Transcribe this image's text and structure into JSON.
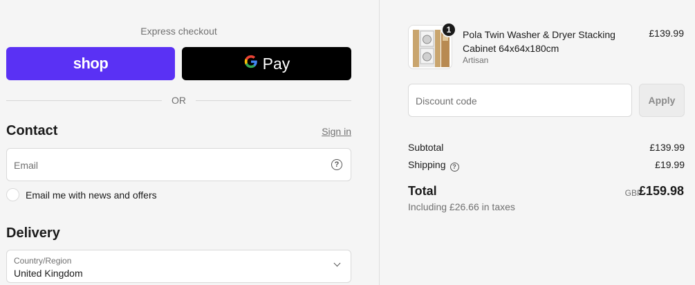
{
  "express": {
    "label": "Express checkout",
    "shop_label": "shop",
    "gpay_g": "G",
    "gpay_label": "Pay",
    "or_label": "OR"
  },
  "contact": {
    "heading": "Contact",
    "signin_label": "Sign in",
    "email_placeholder": "Email",
    "newsletter_label": "Email me with news and offers"
  },
  "delivery": {
    "heading": "Delivery",
    "country_label": "Country/Region",
    "country_value": "United Kingdom"
  },
  "order": {
    "product": {
      "name": "Pola Twin Washer & Dryer Stacking Cabinet 64x64x180cm",
      "variant": "Artisan",
      "price": "£139.99",
      "quantity": "1"
    },
    "discount_placeholder": "Discount code",
    "apply_label": "Apply",
    "subtotal_label": "Subtotal",
    "subtotal_value": "£139.99",
    "shipping_label": "Shipping",
    "shipping_value": "£19.99",
    "total_label": "Total",
    "total_currency": "GBP",
    "total_value": "£159.98",
    "tax_note": "Including £26.66 in taxes"
  },
  "colors": {
    "shop_purple": "#5a31f4",
    "gpay_black": "#000000",
    "background": "#f5f5f5"
  }
}
